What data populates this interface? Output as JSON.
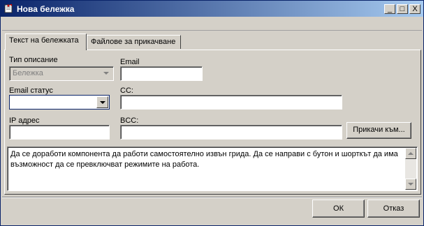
{
  "window": {
    "title": "Нова бележка",
    "controls": {
      "minimize": "_",
      "maximize": "□",
      "close": "X"
    }
  },
  "tabs": [
    {
      "label": "Текст на бележката",
      "active": true
    },
    {
      "label": "Файлове за прикачване",
      "active": false
    }
  ],
  "form": {
    "type_label": "Тип описание",
    "type_value": "Бележка",
    "email_label": "Email",
    "email_value": "",
    "email_status_label": "Email статус",
    "email_status_value": "",
    "cc_label": "CC:",
    "cc_value": "",
    "ip_label": "IP адрес",
    "ip_value": "",
    "bcc_label": "BCC:",
    "bcc_value": "",
    "attach_button": "Прикачи към..."
  },
  "note": {
    "text": "Да се доработи компонента да работи самостоятелно извън грида. Да се направи с бутон и шорткът да има възможност да се превключват режимите на работа."
  },
  "footer": {
    "ok": "ОК",
    "cancel": "Отказ"
  },
  "icons": {
    "app": "note-icon"
  }
}
